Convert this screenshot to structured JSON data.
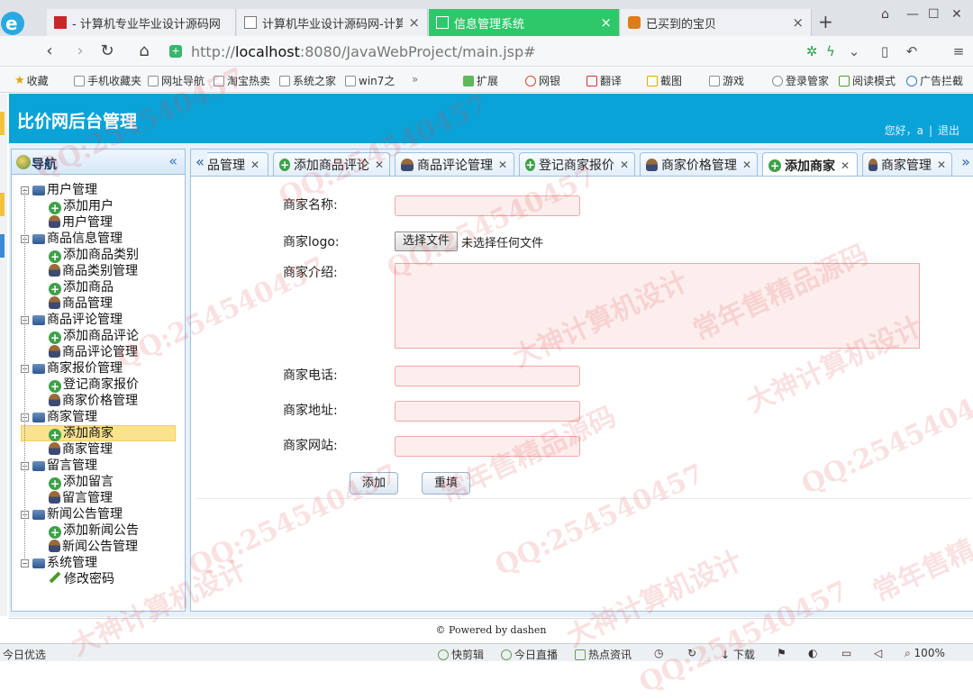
{
  "browser": {
    "tabs": [
      {
        "title": "- 计算机专业毕业设计源码网",
        "active": false
      },
      {
        "title": "计算机毕业设计源码网-计算",
        "active": false
      },
      {
        "title": "信息管理系统",
        "active": true
      },
      {
        "title": "已买到的宝贝",
        "active": false
      }
    ],
    "url": {
      "prefix": "http://",
      "host": "localhost",
      "path": ":8080/JavaWebProject/main.jsp#"
    },
    "bookmarks": [
      "收藏",
      "手机收藏夹",
      "网址导航",
      "淘宝热卖",
      "系统之家",
      "win7之",
      "扩展",
      "网银",
      "翻译",
      "截图",
      "游戏",
      "登录管家",
      "阅读模式",
      "广告拦截"
    ],
    "colors": {
      "active_tab": "#2ec86b"
    }
  },
  "app": {
    "title": "比价网后台管理",
    "welcome": "您好，a",
    "logout": "退出",
    "header_color": "#0aa3d8"
  },
  "nav": {
    "title": "导航",
    "tree": [
      {
        "label": "用户管理",
        "children": [
          {
            "label": "添加用户",
            "icon": "add"
          },
          {
            "label": "用户管理",
            "icon": "user"
          }
        ]
      },
      {
        "label": "商品信息管理",
        "children": [
          {
            "label": "添加商品类别",
            "icon": "add"
          },
          {
            "label": "商品类别管理",
            "icon": "user"
          },
          {
            "label": "添加商品",
            "icon": "add"
          },
          {
            "label": "商品管理",
            "icon": "user"
          }
        ]
      },
      {
        "label": "商品评论管理",
        "children": [
          {
            "label": "添加商品评论",
            "icon": "add"
          },
          {
            "label": "商品评论管理",
            "icon": "user"
          }
        ]
      },
      {
        "label": "商家报价管理",
        "children": [
          {
            "label": "登记商家报价",
            "icon": "add"
          },
          {
            "label": "商家价格管理",
            "icon": "user"
          }
        ]
      },
      {
        "label": "商家管理",
        "children": [
          {
            "label": "添加商家",
            "icon": "add",
            "selected": true
          },
          {
            "label": "商家管理",
            "icon": "user"
          }
        ]
      },
      {
        "label": "留言管理",
        "children": [
          {
            "label": "添加留言",
            "icon": "add"
          },
          {
            "label": "留言管理",
            "icon": "user"
          }
        ]
      },
      {
        "label": "新闻公告管理",
        "children": [
          {
            "label": "添加新闻公告",
            "icon": "add"
          },
          {
            "label": "新闻公告管理",
            "icon": "user"
          }
        ]
      },
      {
        "label": "系统管理",
        "children": [
          {
            "label": "修改密码",
            "icon": "pen"
          }
        ]
      }
    ]
  },
  "tabs": [
    {
      "label": "品管理",
      "icon": "none"
    },
    {
      "label": "添加商品评论",
      "icon": "add"
    },
    {
      "label": "商品评论管理",
      "icon": "user"
    },
    {
      "label": "登记商家报价",
      "icon": "add"
    },
    {
      "label": "商家价格管理",
      "icon": "user"
    },
    {
      "label": "添加商家",
      "icon": "add",
      "active": true
    },
    {
      "label": "商家管理",
      "icon": "user"
    }
  ],
  "form": {
    "name_label": "商家名称:",
    "logo_label": "商家logo:",
    "file_button": "选择文件",
    "file_status": "未选择任何文件",
    "intro_label": "商家介绍:",
    "phone_label": "商家电话:",
    "address_label": "商家地址:",
    "website_label": "商家网站:",
    "add_button": "添加",
    "reset_button": "重填",
    "name_value": "",
    "phone_value": "",
    "address_value": "",
    "website_value": "",
    "intro_value": ""
  },
  "footer": {
    "text": "© Powered by dashen"
  },
  "statusbar": {
    "left": "今日优选",
    "items": [
      "快剪辑",
      "今日直播",
      "热点资讯",
      "下载"
    ],
    "zoom": "100%"
  },
  "watermarks": [
    "QQ:254540457",
    "大神计算机设计",
    "常年售精品源码"
  ]
}
